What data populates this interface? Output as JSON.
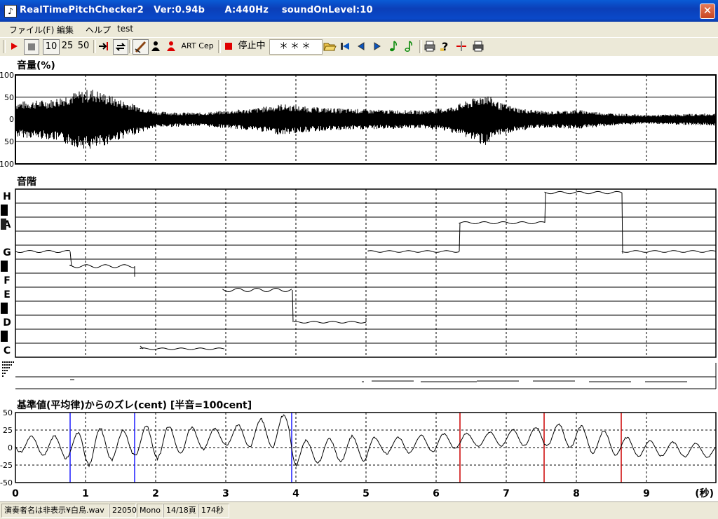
{
  "window": {
    "title": "RealTimePitchChecker2   Ver:0.94b      A:440Hz    soundOnLevel:10",
    "close_label": "✕"
  },
  "menu": [
    {
      "label": "ファイル(F)"
    },
    {
      "label": "編集"
    },
    {
      "label": "ヘルプ"
    },
    {
      "label": "test"
    }
  ],
  "toolbar": {
    "rate_10": "10",
    "rate_25": "25",
    "rate_50": "50",
    "art_label": "ART",
    "cep_label": "Cep",
    "stop_status": "停止中",
    "status_value": "＊＊＊"
  },
  "volume_panel": {
    "title": "音量(%)",
    "ticks": [
      "100",
      "50",
      "0",
      "50",
      "100"
    ]
  },
  "scale_panel": {
    "title": "音階",
    "notes": [
      "H",
      "A",
      "G",
      "F",
      "E",
      "D",
      "C"
    ]
  },
  "deviation_panel": {
    "title": "基準値(平均律)からのズレ(cent) [半音=100cent]",
    "ticks": [
      "50",
      "25",
      "0",
      "-25",
      "-50"
    ]
  },
  "time_axis": {
    "ticks": [
      "0",
      "1",
      "2",
      "3",
      "4",
      "5",
      "6",
      "7",
      "8",
      "9"
    ],
    "unit": "(秒)"
  },
  "status_bar": {
    "file": "演奏者名は非表示¥白鳥.wav",
    "rate": "22050",
    "channels": "Mono",
    "page": "14/18頁",
    "duration": "174秒"
  },
  "colors": {
    "title_bar": "#0b4fd0",
    "plot_line": "#000000",
    "marker_blue": "#1a1aff",
    "marker_red": "#cc0000"
  }
}
